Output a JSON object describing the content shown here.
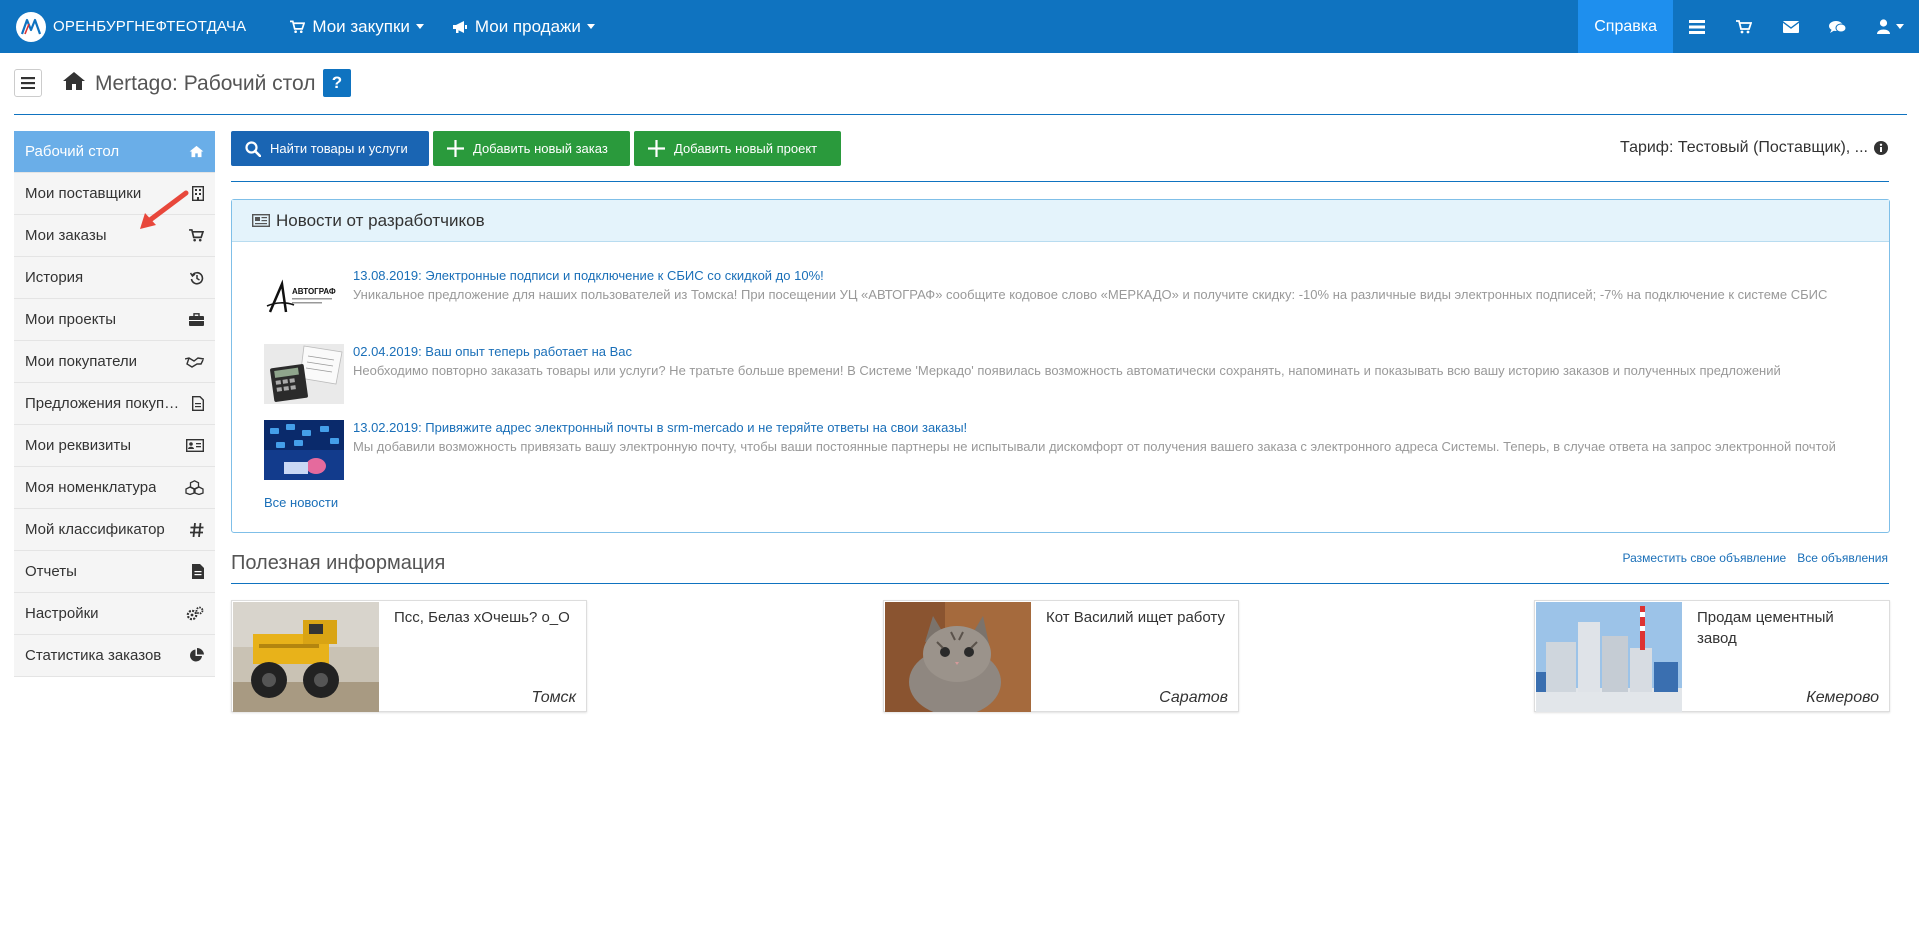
{
  "navbar": {
    "brand": "ОРЕНБУРГНЕФТЕОТДАЧА",
    "purchases": "Мои закупки",
    "sales": "Мои продажи",
    "help": "Справка",
    "icons": [
      "list-icon",
      "cart-icon",
      "envelope-icon",
      "chat-icon",
      "user-icon"
    ]
  },
  "header": {
    "title": "Mertago: Рабочий стол",
    "help_mark": "?"
  },
  "sidebar": {
    "items": [
      {
        "label": "Рабочий стол",
        "icon": "home-icon"
      },
      {
        "label": "Мои поставщики",
        "icon": "building-icon"
      },
      {
        "label": "Мои заказы",
        "icon": "cart-icon"
      },
      {
        "label": "История",
        "icon": "history-icon"
      },
      {
        "label": "Мои проекты",
        "icon": "briefcase-icon"
      },
      {
        "label": "Мои покупатели",
        "icon": "handshake-icon"
      },
      {
        "label": "Предложения покупателей",
        "icon": "document-icon"
      },
      {
        "label": "Мои реквизиты",
        "icon": "id-card-icon"
      },
      {
        "label": "Моя номенклатура",
        "icon": "cubes-icon"
      },
      {
        "label": "Мой классификатор",
        "icon": "hashtag-icon"
      },
      {
        "label": "Отчеты",
        "icon": "report-icon"
      },
      {
        "label": "Настройки",
        "icon": "cogs-icon"
      },
      {
        "label": "Статистика заказов",
        "icon": "pie-chart-icon"
      }
    ]
  },
  "toolbar": {
    "find": "Найти товары и услуги",
    "add_order": "Добавить новый заказ",
    "add_project": "Добавить новый проект",
    "tariff": "Тариф: Тестовый (Поставщик), ..."
  },
  "news": {
    "header": "Новости от разработчиков",
    "items": [
      {
        "title": "13.08.2019: Электронные подписи и подключение к СБИС со скидкой до 10%!",
        "text": "Уникальное предложение для наших пользователей из Томска! При посещении УЦ «АВТОГРАФ» сообщите кодовое слово «МЕРКАДО» и получите скидку: -10% на различные виды электронных подписей; -7% на подключение к системе СБИС",
        "thumb_label": "АВТОГРАФ"
      },
      {
        "title": "02.04.2019: Ваш опыт теперь работает на Вас",
        "text": "Необходимо повторно заказать товары или услуги? Не тратьте больше времени! В Системе 'Меркадо' появилась возможность автоматически сохранять, напоминать и показывать всю вашу историю заказов и полученных предложений"
      },
      {
        "title": "13.02.2019: Привяжите адрес электронный почты в srm-mercado и не теряйте ответы на свои заказы!",
        "text": "Мы добавили возможность привязать вашу электронную почту, чтобы ваши постоянные партнеры не испытывали дискомфорт от получения вашего заказа с электронного адреса Системы. Теперь, в случае ответа на запрос электронной почтой"
      }
    ],
    "all_news": "Все новости"
  },
  "useful": {
    "title": "Полезная информация",
    "post_ad": "Разместить свое объявление",
    "all_ads": "Все объявления",
    "ads": [
      {
        "title": "Псс, Белаз хОчешь? о_О",
        "city": "Томск"
      },
      {
        "title": "Кот Василий ищет работу",
        "city": "Саратов"
      },
      {
        "title": "Продам цементный завод",
        "city": "Кемерово"
      }
    ]
  },
  "colors": {
    "navbar": "#0f73c0",
    "help_tab": "#1e8fee",
    "sidebar_active": "#6aaee8",
    "button_blue": "#1a65b3",
    "button_green": "#2a9a3c",
    "link": "#1a6fb8"
  }
}
